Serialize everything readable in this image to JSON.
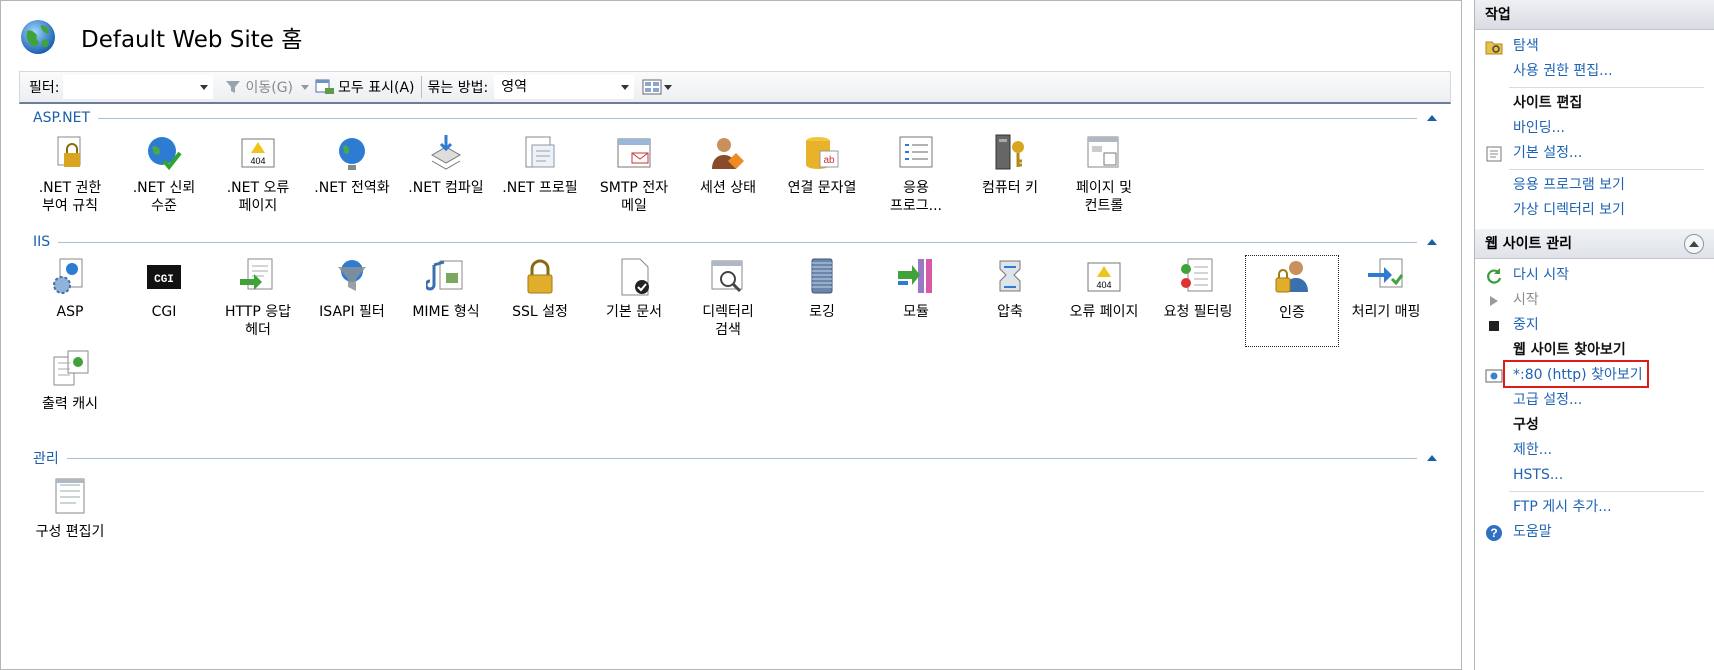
{
  "header": {
    "title": "Default Web Site 홈"
  },
  "toolbar": {
    "filter_label": "필터:",
    "filter_value": "",
    "go_label": "이동(G)",
    "show_all_label": "모두 표시(A)",
    "group_by_label": "묶는 방법:",
    "group_by_value": "영역"
  },
  "sections": {
    "aspnet": {
      "title": "ASP.NET",
      "items": [
        {
          "label": ".NET 권한\n부여 규칙",
          "icon": "lock-doc-icon"
        },
        {
          "label": ".NET 신뢰\n수준",
          "icon": "globe-check-icon"
        },
        {
          "label": ".NET 오류\n페이지",
          "icon": "error-404-icon"
        },
        {
          "label": ".NET 전역화",
          "icon": "globe-icon"
        },
        {
          "label": ".NET 컴파일",
          "icon": "compile-stack-icon"
        },
        {
          "label": ".NET 프로필",
          "icon": "profile-doc-icon"
        },
        {
          "label": "SMTP 전자\n메일",
          "icon": "mail-icon"
        },
        {
          "label": "세션 상태",
          "icon": "session-user-icon"
        },
        {
          "label": "연결 문자열",
          "icon": "database-ab-icon"
        },
        {
          "label": "응용\n프로그...",
          "icon": "app-settings-icon"
        },
        {
          "label": "컴퓨터 키",
          "icon": "machine-key-icon"
        },
        {
          "label": "페이지 및\n컨트롤",
          "icon": "pages-controls-icon"
        }
      ]
    },
    "iis": {
      "title": "IIS",
      "items": [
        {
          "label": "ASP",
          "icon": "asp-gear-icon"
        },
        {
          "label": "CGI",
          "icon": "cgi-icon"
        },
        {
          "label": "HTTP 응답\n헤더",
          "icon": "http-headers-icon"
        },
        {
          "label": "ISAPI 필터",
          "icon": "isapi-filter-icon"
        },
        {
          "label": "MIME 형식",
          "icon": "mime-icon"
        },
        {
          "label": "SSL 설정",
          "icon": "padlock-icon"
        },
        {
          "label": "기본 문서",
          "icon": "default-doc-icon"
        },
        {
          "label": "디렉터리\n검색",
          "icon": "directory-browse-icon"
        },
        {
          "label": "로깅",
          "icon": "logging-icon"
        },
        {
          "label": "모듈",
          "icon": "modules-icon"
        },
        {
          "label": "압축",
          "icon": "compression-icon"
        },
        {
          "label": "오류 페이지",
          "icon": "error-pages-icon"
        },
        {
          "label": "요청 필터링",
          "icon": "request-filter-icon"
        },
        {
          "label": "인증",
          "icon": "authentication-icon",
          "selected": true
        },
        {
          "label": "처리기 매핑",
          "icon": "handler-mapping-icon"
        },
        {
          "label": "출력 캐시",
          "icon": "output-cache-icon"
        }
      ]
    },
    "management": {
      "title": "관리",
      "items": [
        {
          "label": "구성 편집기",
          "icon": "config-editor-icon"
        }
      ]
    }
  },
  "actions": {
    "header": "작업",
    "explore": "탐색",
    "edit_permissions": "사용 권한 편집...",
    "edit_site_title": "사이트 편집",
    "bindings": "바인딩...",
    "basic_settings": "기본 설정...",
    "view_applications": "응용 프로그램 보기",
    "view_virtual_dirs": "가상 디렉터리 보기",
    "manage_site_header": "웹 사이트 관리",
    "restart": "다시 시작",
    "start": "시작",
    "stop": "중지",
    "browse_title": "웹 사이트 찾아보기",
    "browse_link": "*:80 (http) 찾아보기",
    "advanced_settings": "고급 설정...",
    "configure_title": "구성",
    "limits": "제한...",
    "hsts": "HSTS...",
    "add_ftp": "FTP 게시 추가...",
    "help": "도움말"
  }
}
